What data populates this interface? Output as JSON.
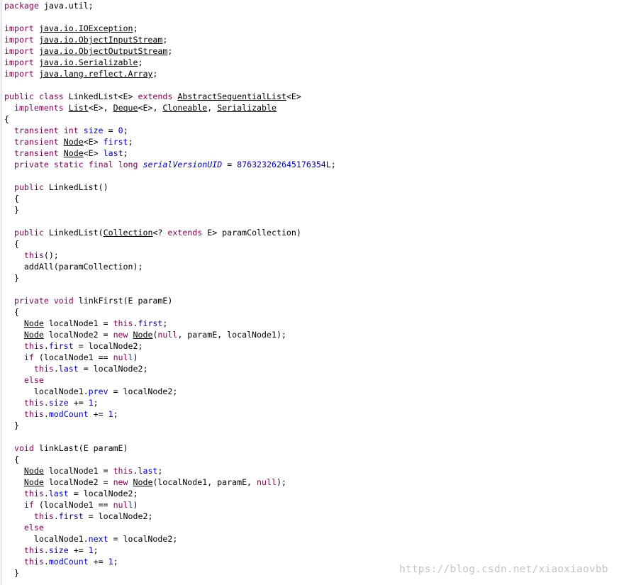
{
  "editor": {
    "lines": [
      [
        {
          "t": "package",
          "c": "kw"
        },
        {
          "t": " java.util;"
        }
      ],
      [],
      [
        {
          "t": "import",
          "c": "kw"
        },
        {
          "t": " "
        },
        {
          "t": "java.io.IOException",
          "c": "typ"
        },
        {
          "t": ";"
        }
      ],
      [
        {
          "t": "import",
          "c": "kw"
        },
        {
          "t": " "
        },
        {
          "t": "java.io.ObjectInputStream",
          "c": "typ"
        },
        {
          "t": ";"
        }
      ],
      [
        {
          "t": "import",
          "c": "kw"
        },
        {
          "t": " "
        },
        {
          "t": "java.io.ObjectOutputStream",
          "c": "typ"
        },
        {
          "t": ";"
        }
      ],
      [
        {
          "t": "import",
          "c": "kw"
        },
        {
          "t": " "
        },
        {
          "t": "java.io.Serializable",
          "c": "typ"
        },
        {
          "t": ";"
        }
      ],
      [
        {
          "t": "import",
          "c": "kw"
        },
        {
          "t": " "
        },
        {
          "t": "java.lang.reflect.Array",
          "c": "typ"
        },
        {
          "t": ";"
        }
      ],
      [],
      [
        {
          "t": "public",
          "c": "kw"
        },
        {
          "t": " "
        },
        {
          "t": "class",
          "c": "kw"
        },
        {
          "t": " LinkedList<E> "
        },
        {
          "t": "extends",
          "c": "kw"
        },
        {
          "t": " "
        },
        {
          "t": "AbstractSequentialList",
          "c": "typ"
        },
        {
          "t": "<E>"
        }
      ],
      [
        {
          "t": "  "
        },
        {
          "t": "implements",
          "c": "kw"
        },
        {
          "t": " "
        },
        {
          "t": "List",
          "c": "typ"
        },
        {
          "t": "<E>, "
        },
        {
          "t": "Deque",
          "c": "typ"
        },
        {
          "t": "<E>, "
        },
        {
          "t": "Cloneable",
          "c": "typ"
        },
        {
          "t": ", "
        },
        {
          "t": "Serializable",
          "c": "typ"
        }
      ],
      [
        {
          "t": "{"
        }
      ],
      [
        {
          "t": "  "
        },
        {
          "t": "transient",
          "c": "kw"
        },
        {
          "t": " "
        },
        {
          "t": "int",
          "c": "kw"
        },
        {
          "t": " "
        },
        {
          "t": "size",
          "c": "fld"
        },
        {
          "t": " = "
        },
        {
          "t": "0",
          "c": "num"
        },
        {
          "t": ";"
        }
      ],
      [
        {
          "t": "  "
        },
        {
          "t": "transient",
          "c": "kw"
        },
        {
          "t": " "
        },
        {
          "t": "Node",
          "c": "typ"
        },
        {
          "t": "<E> "
        },
        {
          "t": "first",
          "c": "fld"
        },
        {
          "t": ";"
        }
      ],
      [
        {
          "t": "  "
        },
        {
          "t": "transient",
          "c": "kw"
        },
        {
          "t": " "
        },
        {
          "t": "Node",
          "c": "typ"
        },
        {
          "t": "<E> "
        },
        {
          "t": "last",
          "c": "fld"
        },
        {
          "t": ";"
        }
      ],
      [
        {
          "t": "  "
        },
        {
          "t": "private",
          "c": "kw"
        },
        {
          "t": " "
        },
        {
          "t": "static",
          "c": "kw"
        },
        {
          "t": " "
        },
        {
          "t": "final",
          "c": "kw"
        },
        {
          "t": " "
        },
        {
          "t": "long",
          "c": "kw"
        },
        {
          "t": " "
        },
        {
          "t": "serialVersionUID",
          "c": "sfld"
        },
        {
          "t": " = "
        },
        {
          "t": "876323262645176354L",
          "c": "num"
        },
        {
          "t": ";"
        }
      ],
      [],
      [
        {
          "t": "  "
        },
        {
          "t": "public",
          "c": "kw"
        },
        {
          "t": " LinkedList()"
        }
      ],
      [
        {
          "t": "  {"
        }
      ],
      [
        {
          "t": "  }"
        }
      ],
      [],
      [
        {
          "t": "  "
        },
        {
          "t": "public",
          "c": "kw"
        },
        {
          "t": " LinkedList("
        },
        {
          "t": "Collection",
          "c": "typ"
        },
        {
          "t": "<? "
        },
        {
          "t": "extends",
          "c": "kw"
        },
        {
          "t": " E> paramCollection)"
        }
      ],
      [
        {
          "t": "  {"
        }
      ],
      [
        {
          "t": "    "
        },
        {
          "t": "this",
          "c": "kw"
        },
        {
          "t": "();"
        }
      ],
      [
        {
          "t": "    addAll(paramCollection);"
        }
      ],
      [
        {
          "t": "  }"
        }
      ],
      [],
      [
        {
          "t": "  "
        },
        {
          "t": "private",
          "c": "kw"
        },
        {
          "t": " "
        },
        {
          "t": "void",
          "c": "kw"
        },
        {
          "t": " linkFirst(E paramE)"
        }
      ],
      [
        {
          "t": "  {"
        }
      ],
      [
        {
          "t": "    "
        },
        {
          "t": "Node",
          "c": "typ"
        },
        {
          "t": " localNode1 = "
        },
        {
          "t": "this",
          "c": "kw"
        },
        {
          "t": "."
        },
        {
          "t": "first",
          "c": "fld"
        },
        {
          "t": ";"
        }
      ],
      [
        {
          "t": "    "
        },
        {
          "t": "Node",
          "c": "typ"
        },
        {
          "t": " localNode2 = "
        },
        {
          "t": "new",
          "c": "kw"
        },
        {
          "t": " "
        },
        {
          "t": "Node",
          "c": "typ"
        },
        {
          "t": "("
        },
        {
          "t": "null",
          "c": "kw"
        },
        {
          "t": ", paramE, localNode1);"
        }
      ],
      [
        {
          "t": "    "
        },
        {
          "t": "this",
          "c": "kw"
        },
        {
          "t": "."
        },
        {
          "t": "first",
          "c": "fld"
        },
        {
          "t": " = localNode2;"
        }
      ],
      [
        {
          "t": "    "
        },
        {
          "t": "if",
          "c": "kw"
        },
        {
          "t": " (localNode1 == "
        },
        {
          "t": "null",
          "c": "kw"
        },
        {
          "t": ")"
        }
      ],
      [
        {
          "t": "      "
        },
        {
          "t": "this",
          "c": "kw"
        },
        {
          "t": "."
        },
        {
          "t": "last",
          "c": "fld"
        },
        {
          "t": " = localNode2;"
        }
      ],
      [
        {
          "t": "    "
        },
        {
          "t": "else",
          "c": "kw"
        }
      ],
      [
        {
          "t": "      localNode1."
        },
        {
          "t": "prev",
          "c": "fld"
        },
        {
          "t": " = localNode2;"
        }
      ],
      [
        {
          "t": "    "
        },
        {
          "t": "this",
          "c": "kw"
        },
        {
          "t": "."
        },
        {
          "t": "size",
          "c": "fld"
        },
        {
          "t": " += "
        },
        {
          "t": "1",
          "c": "num"
        },
        {
          "t": ";"
        }
      ],
      [
        {
          "t": "    "
        },
        {
          "t": "this",
          "c": "kw"
        },
        {
          "t": "."
        },
        {
          "t": "modCount",
          "c": "fld"
        },
        {
          "t": " += "
        },
        {
          "t": "1",
          "c": "num"
        },
        {
          "t": ";"
        }
      ],
      [
        {
          "t": "  }"
        }
      ],
      [],
      [
        {
          "t": "  "
        },
        {
          "t": "void",
          "c": "kw"
        },
        {
          "t": " linkLast(E paramE)"
        }
      ],
      [
        {
          "t": "  {"
        }
      ],
      [
        {
          "t": "    "
        },
        {
          "t": "Node",
          "c": "typ"
        },
        {
          "t": " localNode1 = "
        },
        {
          "t": "this",
          "c": "kw"
        },
        {
          "t": "."
        },
        {
          "t": "last",
          "c": "fld"
        },
        {
          "t": ";"
        }
      ],
      [
        {
          "t": "    "
        },
        {
          "t": "Node",
          "c": "typ"
        },
        {
          "t": " localNode2 = "
        },
        {
          "t": "new",
          "c": "kw"
        },
        {
          "t": " "
        },
        {
          "t": "Node",
          "c": "typ"
        },
        {
          "t": "(localNode1, paramE, "
        },
        {
          "t": "null",
          "c": "kw"
        },
        {
          "t": ");"
        }
      ],
      [
        {
          "t": "    "
        },
        {
          "t": "this",
          "c": "kw"
        },
        {
          "t": "."
        },
        {
          "t": "last",
          "c": "fld"
        },
        {
          "t": " = localNode2;"
        }
      ],
      [
        {
          "t": "    "
        },
        {
          "t": "if",
          "c": "kw"
        },
        {
          "t": " (localNode1 == "
        },
        {
          "t": "null",
          "c": "kw"
        },
        {
          "t": ")"
        }
      ],
      [
        {
          "t": "      "
        },
        {
          "t": "this",
          "c": "kw"
        },
        {
          "t": "."
        },
        {
          "t": "first",
          "c": "fld"
        },
        {
          "t": " = localNode2;"
        }
      ],
      [
        {
          "t": "    "
        },
        {
          "t": "else",
          "c": "kw"
        }
      ],
      [
        {
          "t": "      localNode1."
        },
        {
          "t": "next",
          "c": "fld"
        },
        {
          "t": " = localNode2;"
        }
      ],
      [
        {
          "t": "    "
        },
        {
          "t": "this",
          "c": "kw"
        },
        {
          "t": "."
        },
        {
          "t": "size",
          "c": "fld"
        },
        {
          "t": " += "
        },
        {
          "t": "1",
          "c": "num"
        },
        {
          "t": ";"
        }
      ],
      [
        {
          "t": "    "
        },
        {
          "t": "this",
          "c": "kw"
        },
        {
          "t": "."
        },
        {
          "t": "modCount",
          "c": "fld"
        },
        {
          "t": " += "
        },
        {
          "t": "1",
          "c": "num"
        },
        {
          "t": ";"
        }
      ],
      [
        {
          "t": "  }"
        }
      ]
    ]
  },
  "watermark": {
    "text": "https://blog.csdn.net/xiaoxiaovbb"
  },
  "colors": {
    "keyword": "#7f0055",
    "field": "#0000c0",
    "text": "#000000",
    "background": "#ffffff",
    "watermark": "#c4c4c4"
  }
}
